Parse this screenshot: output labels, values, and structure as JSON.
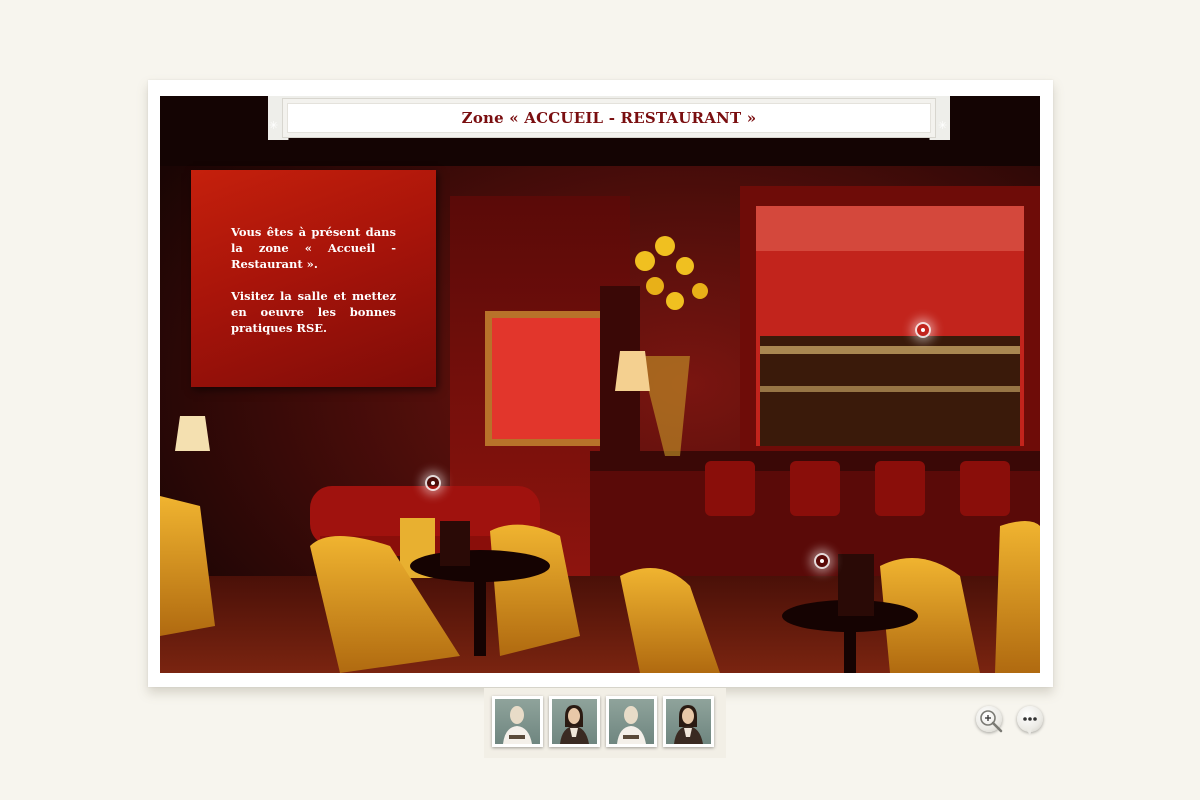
{
  "title_bar": {
    "text": "Zone « ACCUEIL - RESTAURANT »"
  },
  "info_panel": {
    "paragraph1": "Vous êtes à présent dans la zone « Accueil - Restaurant ».",
    "paragraph2": "Visitez la salle et mettez en oeuvre les bonnes pratiques RSE."
  },
  "scene": {
    "description_icon": "restaurant-bar-photo-icon"
  },
  "hotspots": [
    "sofa-hotspot",
    "bar-shelf-hotspot",
    "table-hotspot"
  ],
  "thumbnails": [
    {
      "icon": "character-man-icon"
    },
    {
      "icon": "character-woman-icon"
    },
    {
      "icon": "character-man-icon"
    },
    {
      "icon": "character-woman-icon"
    }
  ],
  "controls": {
    "zoom_icon": "zoom-in-icon",
    "more_icon": "more-options-icon"
  },
  "colors": {
    "title_text": "#7a0e10",
    "info_panel": "#b0180a",
    "page_bg": "#f7f5ee"
  }
}
